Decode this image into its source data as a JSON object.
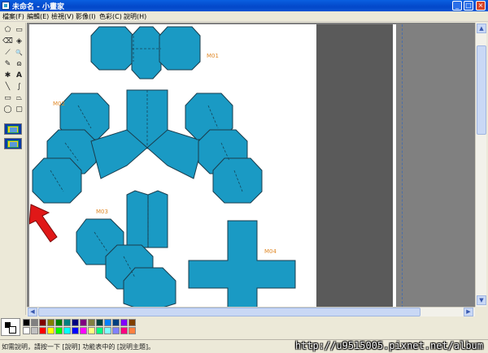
{
  "window": {
    "title": "未命名 - 小畫家",
    "minimize": "_",
    "maximize": "□",
    "close": "×"
  },
  "menu": [
    {
      "label": "檔案(F)"
    },
    {
      "label": "編輯(E)"
    },
    {
      "label": "檢視(V)"
    },
    {
      "label": "影像(I)"
    },
    {
      "label": "色彩(C)"
    },
    {
      "label": "說明(H)"
    }
  ],
  "tools": [
    {
      "name": "free-select-icon",
      "glyph": "⬠"
    },
    {
      "name": "rect-select-icon",
      "glyph": "▭"
    },
    {
      "name": "eraser-icon",
      "glyph": "⌫"
    },
    {
      "name": "fill-icon",
      "glyph": "◈"
    },
    {
      "name": "color-picker-icon",
      "glyph": "⟋"
    },
    {
      "name": "magnifier-icon",
      "glyph": "🔍"
    },
    {
      "name": "pencil-icon",
      "glyph": "✎"
    },
    {
      "name": "brush-icon",
      "glyph": "ɷ"
    },
    {
      "name": "airbrush-icon",
      "glyph": "✱"
    },
    {
      "name": "text-icon",
      "glyph": "A"
    },
    {
      "name": "line-icon",
      "glyph": "╲"
    },
    {
      "name": "curve-icon",
      "glyph": "∫"
    },
    {
      "name": "rectangle-icon",
      "glyph": "▭"
    },
    {
      "name": "polygon-icon",
      "glyph": "⏢"
    },
    {
      "name": "ellipse-icon",
      "glyph": "◯"
    },
    {
      "name": "rounded-rect-icon",
      "glyph": "▢"
    }
  ],
  "canvas": {
    "labels": {
      "m01": "M01",
      "m02": "M02",
      "m03": "M03",
      "m04": "M04"
    },
    "piece_color": "#1a9ac4",
    "label_color": "#e08a2a",
    "arrow_color": "#e01818"
  },
  "palette": {
    "colors": [
      "#000000",
      "#808080",
      "#800000",
      "#808000",
      "#008000",
      "#008080",
      "#000080",
      "#800080",
      "#808040",
      "#004040",
      "#0080ff",
      "#004080",
      "#8000ff",
      "#804000",
      "#ffffff",
      "#c0c0c0",
      "#ff0000",
      "#ffff00",
      "#00ff00",
      "#00ffff",
      "#0000ff",
      "#ff00ff",
      "#ffff80",
      "#00ff80",
      "#80ffff",
      "#8080ff",
      "#ff0080",
      "#ff8040"
    ]
  },
  "status": {
    "text": "如需說明，請按一下 [說明] 功能表中的 [說明主題]。",
    "watermark": "http://u9515005.pixnet.net/album"
  }
}
